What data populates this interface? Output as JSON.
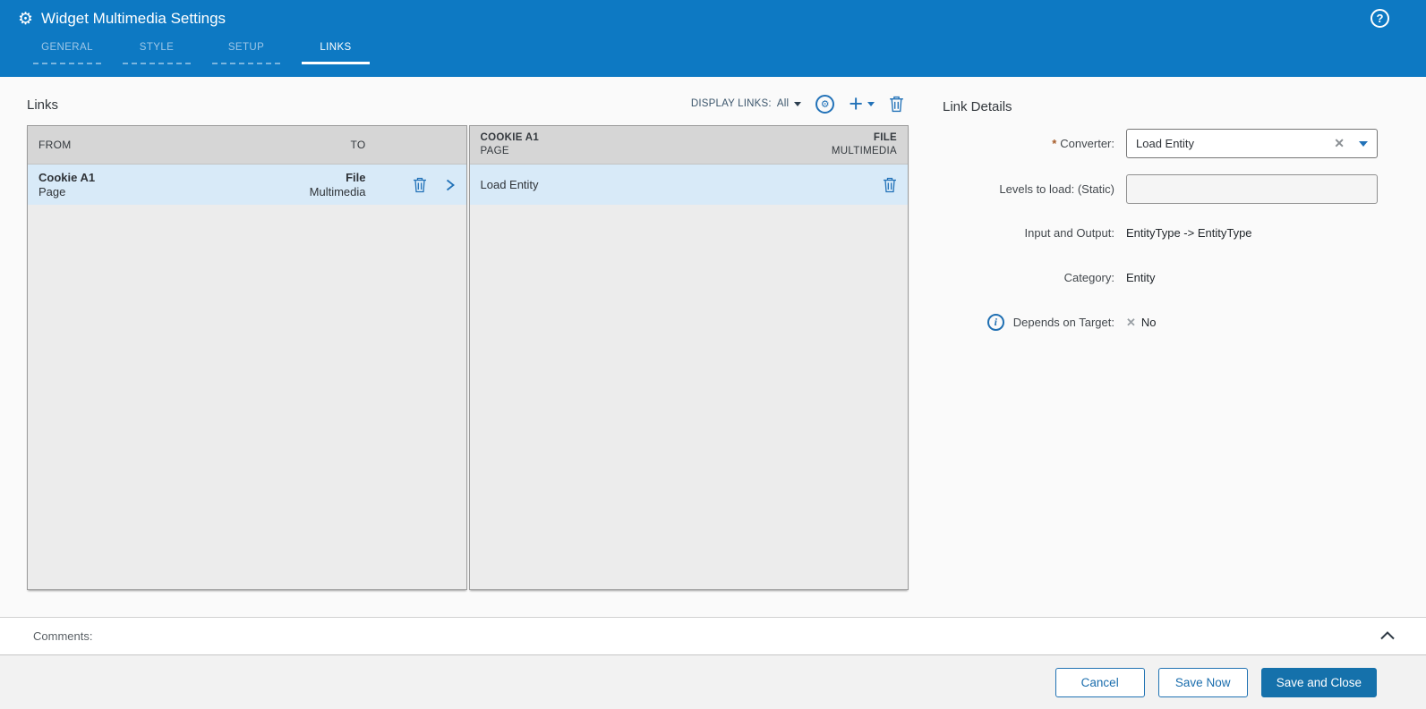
{
  "window": {
    "title": "Widget Multimedia Settings"
  },
  "tabs": [
    {
      "label": "GENERAL",
      "active": false
    },
    {
      "label": "STYLE",
      "active": false
    },
    {
      "label": "SETUP",
      "active": false
    },
    {
      "label": "LINKS",
      "active": true
    }
  ],
  "links": {
    "section_title": "Links",
    "toolbar": {
      "display_links_label": "DISPLAY LINKS:",
      "display_links_value": "All"
    },
    "pair_table": {
      "col_from": "FROM",
      "col_to": "TO",
      "row": {
        "from_name": "Cookie A1",
        "from_type": "Page",
        "to_name": "File",
        "to_type": "Multimedia"
      }
    },
    "detail_table": {
      "header_left_name": "COOKIE A1",
      "header_left_type": "PAGE",
      "header_right_name": "FILE",
      "header_right_type": "MULTIMEDIA",
      "row": {
        "converter": "Load Entity"
      }
    }
  },
  "details": {
    "title": "Link Details",
    "required_marker": "*",
    "converter_label": "Converter:",
    "converter_value": "Load Entity",
    "levels_label": "Levels to load: (Static)",
    "levels_value": "",
    "io_label": "Input and Output:",
    "io_value": "EntityType -> EntityType",
    "category_label": "Category:",
    "category_value": "Entity",
    "depends_label": "Depends on Target:",
    "depends_x": "✕",
    "depends_value": "No"
  },
  "comments": {
    "label": "Comments:"
  },
  "footer": {
    "cancel_label": "Cancel",
    "save_now_label": "Save Now",
    "save_close_label": "Save and Close"
  },
  "icons": {
    "gear_glyph": "⚙",
    "help_glyph": "?",
    "autolink_glyph": "⚙",
    "add_glyph": "+",
    "clear_glyph": "✕",
    "info_glyph": "i"
  },
  "colors": {
    "header_blue": "#0d79c3",
    "accent_blue": "#2272b8",
    "selected_row_blue": "#d8eaf8",
    "table_header_gray": "#d6d6d6",
    "table_body_gray": "#ececec",
    "primary_button_blue": "#1571ab",
    "required_marker_orange": "#a65b28"
  }
}
